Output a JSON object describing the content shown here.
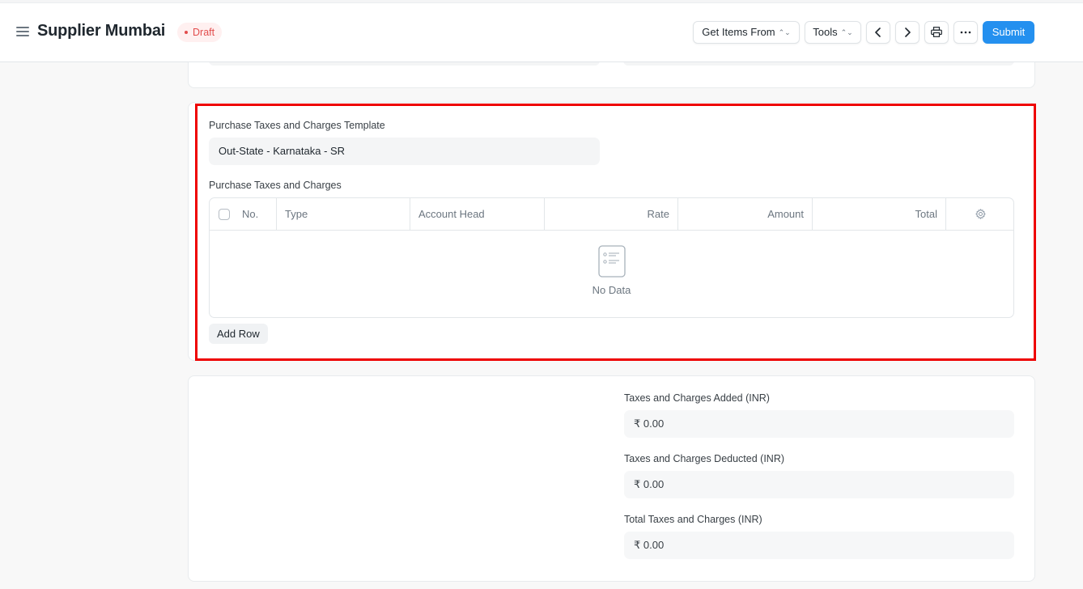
{
  "header": {
    "title": "Supplier Mumbai",
    "status": "Draft",
    "get_items_label": "Get Items From",
    "tools_label": "Tools",
    "submit_label": "Submit"
  },
  "tax_section": {
    "template_label": "Purchase Taxes and Charges Template",
    "template_value": "Out-State - Karnataka - SR",
    "table_label": "Purchase Taxes and Charges",
    "columns": [
      "No.",
      "Type",
      "Account Head",
      "Rate",
      "Amount",
      "Total"
    ],
    "empty_text": "No Data",
    "add_row_label": "Add Row"
  },
  "totals": {
    "added_label": "Taxes and Charges Added (INR)",
    "added_value": "₹ 0.00",
    "deducted_label": "Taxes and Charges Deducted (INR)",
    "deducted_value": "₹ 0.00",
    "total_label": "Total Taxes and Charges (INR)",
    "total_value": "₹ 0.00"
  },
  "colors": {
    "primary": "#2490ef",
    "draft": "#e24c4c",
    "highlight": "#ee0000"
  }
}
